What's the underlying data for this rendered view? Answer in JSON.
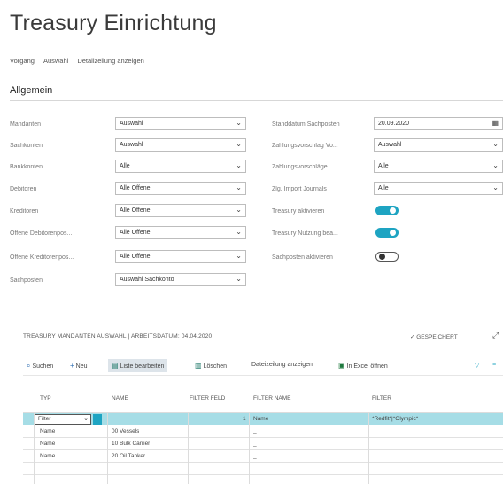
{
  "page": {
    "title": "Treasury Einrichtung"
  },
  "actions": [
    "Vorgang",
    "Auswahl",
    "Detailzeilung anzeigen"
  ],
  "section": {
    "title": "Allgemein"
  },
  "left_fields": [
    {
      "label": "Mandanten",
      "value": "Auswahl"
    },
    {
      "label": "Sachkonten",
      "value": "Auswahl"
    },
    {
      "label": "Bankkonten",
      "value": "Alle"
    },
    {
      "label": "Debitoren",
      "value": "Alle Offene"
    },
    {
      "label": "Kreditoren",
      "value": "Alle Offene"
    },
    {
      "label": "Offene Debitorenpos...",
      "value": "Alle Offene"
    },
    {
      "label": "Offene Kreditorenpos...",
      "value": "Alle Offene"
    },
    {
      "label": "Sachposten",
      "value": "Auswahl Sachkonto"
    }
  ],
  "right_fields": [
    {
      "label": "Standdatum Sachposten",
      "value": "20.09.2020"
    },
    {
      "label": "Zahlungsvorschlag Vo...",
      "value": "Auswahl"
    },
    {
      "label": "Zahlungsvorschläge",
      "value": "Alle"
    },
    {
      "label": "Zlg. Import Journals",
      "value": "Alle"
    },
    {
      "label": "Treasury aktivieren",
      "toggle": "on"
    },
    {
      "label": "Treasury Nutzung bea...",
      "toggle": "on"
    },
    {
      "label": "Sachposten aktivieren",
      "toggle": "off"
    }
  ],
  "list": {
    "title": "TREASURY MANDANTEN AUSWAHL | ARBEITSDATUM: 04.04.2020",
    "saved": "✓ GESPEICHERT",
    "toolbar": {
      "search": "Suchen",
      "new": "Neu",
      "edit_list": "Liste bearbeiten",
      "delete": "Löschen",
      "details": "Dateizeilung anzeigen",
      "excel": "In Excel öffnen"
    },
    "columns": [
      "TYP",
      "NAME",
      "FILTER FELD",
      "FILTER NAME",
      "FILTER"
    ],
    "rows": [
      {
        "typ": "Filter",
        "name": "",
        "filter_feld": "1",
        "filter_name": "Name",
        "filter": "*Redfit*|*Olympic*"
      },
      {
        "typ": "Name",
        "name": "00 Vessels",
        "filter_feld": "",
        "filter_name": "_",
        "filter": ""
      },
      {
        "typ": "Name",
        "name": "10 Bulk Carrier",
        "filter_feld": "",
        "filter_name": "_",
        "filter": ""
      },
      {
        "typ": "Name",
        "name": "20 Oil Tanker",
        "filter_feld": "",
        "filter_name": "_",
        "filter": ""
      }
    ]
  },
  "colors": {
    "accent": "#1ea4c2",
    "selected_row": "#a6dde6"
  }
}
